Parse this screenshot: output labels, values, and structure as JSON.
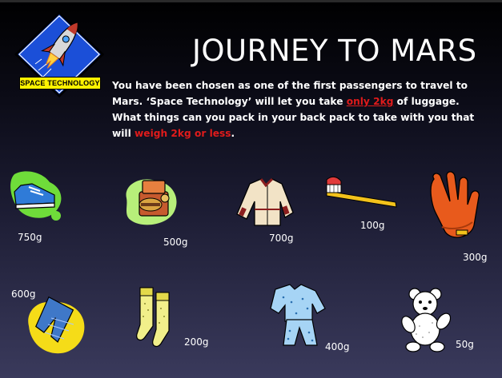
{
  "logo": {
    "text": "SPACE TECHNOLOGY",
    "icon": "rocket-icon"
  },
  "title": "JOURNEY TO MARS",
  "intro": {
    "p1": "You have been chosen as one of the first passengers to travel to Mars. ‘Space Technology’ will let you take ",
    "highlight1": "only 2kg",
    "p2": " of luggage. What things can you pack in your back pack to take with you that will ",
    "highlight2": "weigh 2kg or less",
    "p3": "."
  },
  "colors": {
    "highlight": "#e01b1b",
    "logo_bg": "#1b4fd8",
    "logo_label": "#fff200"
  },
  "items": [
    {
      "icon": "sneaker-icon",
      "weight": "750g"
    },
    {
      "icon": "lunchbox-icon",
      "weight": "500g"
    },
    {
      "icon": "jacket-icon",
      "weight": "700g"
    },
    {
      "icon": "toothbrush-icon",
      "weight": "100g"
    },
    {
      "icon": "glove-icon",
      "weight": "300g"
    },
    {
      "icon": "jeans-icon",
      "weight": "600g"
    },
    {
      "icon": "socks-icon",
      "weight": "200g"
    },
    {
      "icon": "pajamas-icon",
      "weight": "400g"
    },
    {
      "icon": "teddy-bear-icon",
      "weight": "50g"
    }
  ]
}
